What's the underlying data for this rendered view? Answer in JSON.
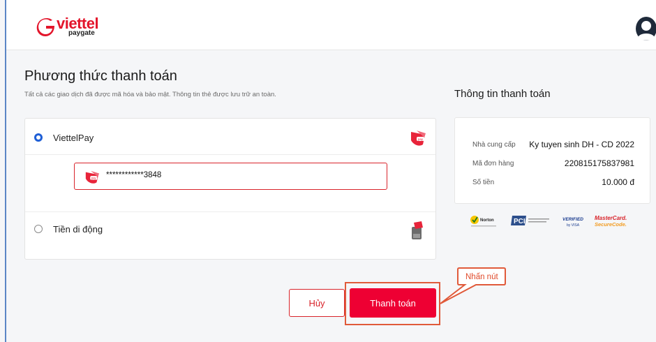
{
  "header": {
    "logo_viettel": "viettel",
    "logo_paygate": "paygate",
    "brand_color": "#e3152b"
  },
  "main": {
    "title": "Phương thức thanh toán",
    "subtitle": "Tất cả các giao dịch đã được mã hóa và bảo mật. Thông tin thẻ được lưu trữ an toàn.",
    "methods": [
      {
        "label": "ViettelPay",
        "selected": true,
        "icon": "viettelpay-icon"
      },
      {
        "label": "Tiền di động",
        "selected": false,
        "icon": "mobile-money-icon"
      }
    ],
    "saved_card": {
      "number": "************3848",
      "icon": "viettelpay-icon"
    }
  },
  "payment_info": {
    "title": "Thông tin thanh toán",
    "rows": [
      {
        "key": "Nhà cung cấp",
        "value": "Ky tuyen sinh DH - CD 2022"
      },
      {
        "key": "Mã đơn hàng",
        "value": "220815175837981"
      },
      {
        "key": "Số tiền",
        "value": "10.000 đ"
      }
    ],
    "badges": [
      "Norton",
      "PCI",
      "VERIFIED by VISA",
      "MasterCard. SecureCode."
    ]
  },
  "actions": {
    "cancel_label": "Hủy",
    "pay_label": "Thanh toán",
    "accent_color": "#ee0033"
  },
  "annotation": {
    "callout_text": "Nhấn nút",
    "color": "#e05a3a"
  }
}
